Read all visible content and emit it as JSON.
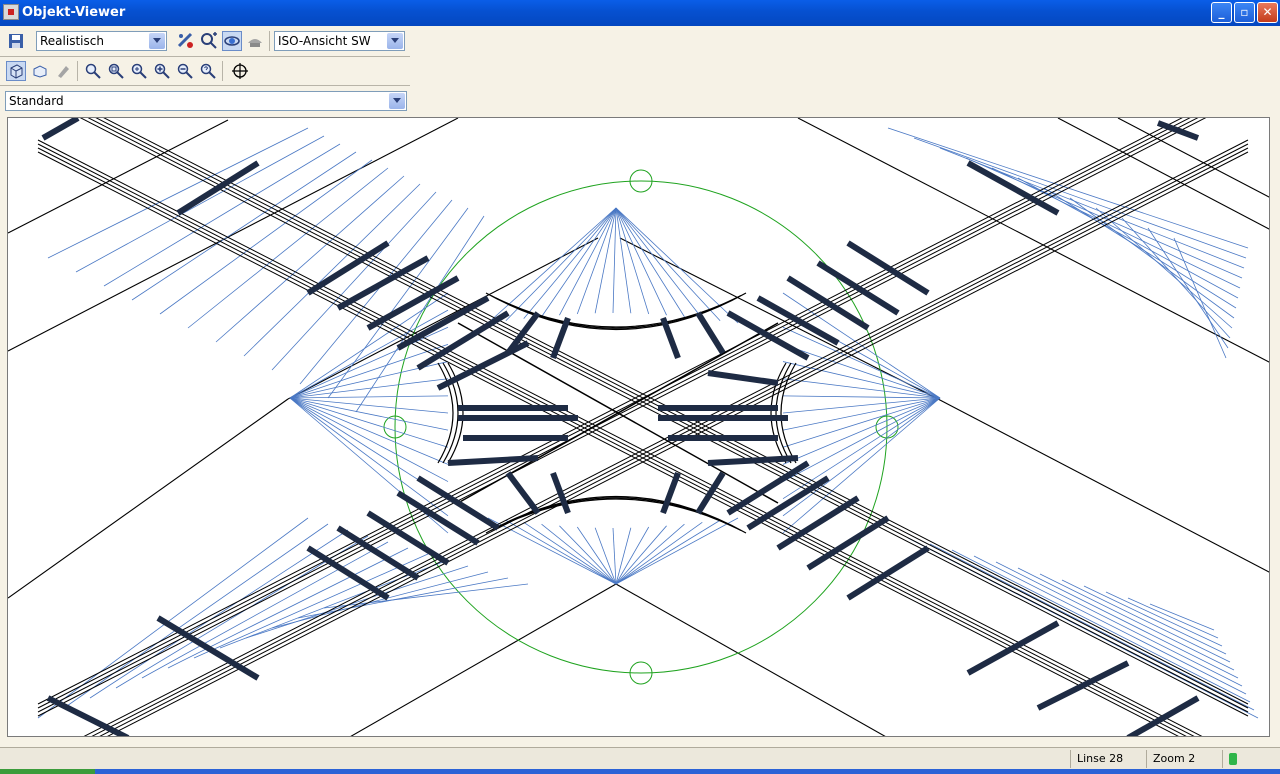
{
  "window": {
    "title": "Objekt-Viewer"
  },
  "toolbar": {
    "visual_style": "Realistisch",
    "view": "ISO-Ansicht SW",
    "ucs": "Standard"
  },
  "icons": {
    "app": "application-icon",
    "save": "save-icon",
    "zoom_extents": "zoom-extents-icon",
    "zoom_window": "zoom-window-icon",
    "zoom_in": "zoom-in-icon",
    "zoom_out": "zoom-out-icon"
  },
  "status": {
    "linse": "Linse 28",
    "zoom": "Zoom 2"
  },
  "colors": {
    "title_bar": "#0a5ee8",
    "background": "#f6f2e6",
    "circle": "#1fa31f",
    "helper_lines": "#4a78c4"
  }
}
